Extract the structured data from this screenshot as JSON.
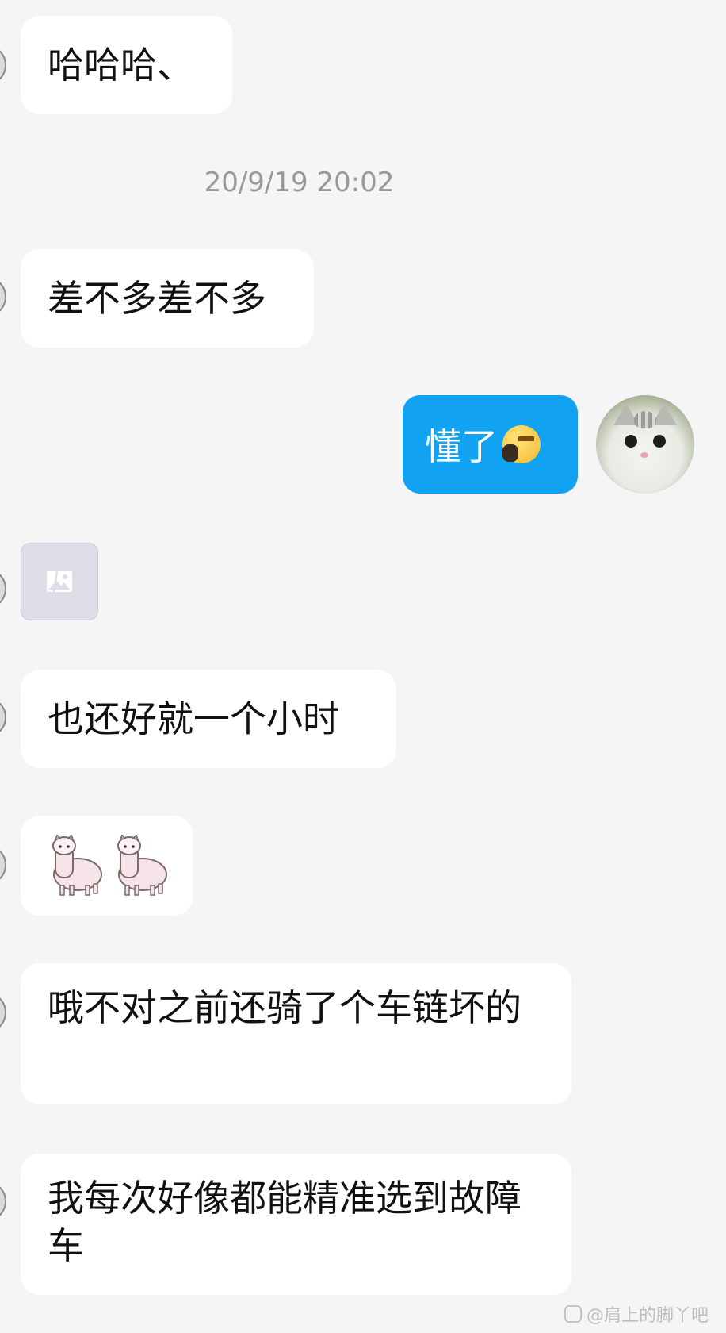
{
  "messages": {
    "m1": "哈哈哈、",
    "timestamp": "20/9/19 20:02",
    "m2": "差不多差不多",
    "outgoing": "懂了",
    "m3": "也还好就一个小时",
    "m4": "哦不对之前还骑了个车链坏的",
    "m5": "我每次好像都能精准选到故障车"
  },
  "icons": {
    "outgoing_emoji": "facepalm-emoji-icon",
    "self_avatar": "cat-avatar",
    "image_placeholder": "broken-image-icon",
    "sticker": "alpaca-sticker-icon"
  },
  "watermark": "@肩上的脚丫吧",
  "colors": {
    "background": "#f5f5f5",
    "incoming_bubble": "#ffffff",
    "outgoing_bubble": "#12a2f2",
    "timestamp_text": "#999999"
  }
}
